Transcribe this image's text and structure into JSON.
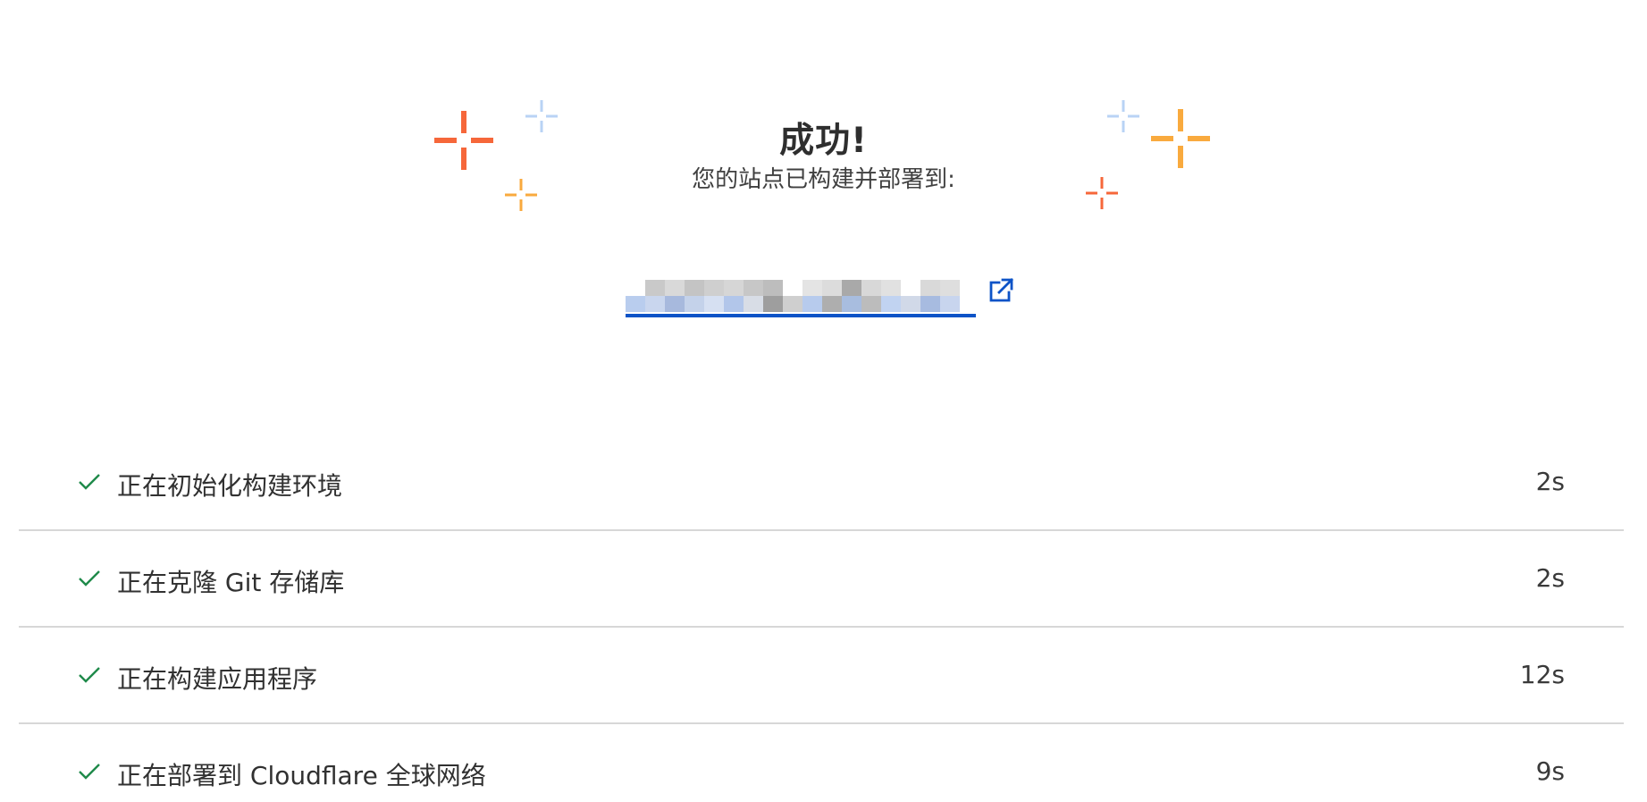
{
  "success": {
    "title": "成功!",
    "subtitle": "您的站点已构建并部署到:",
    "deployment_url": ""
  },
  "icons": {
    "external_link": "external-link-icon",
    "step_status": "check-icon",
    "decoration": "sparkle-icon"
  },
  "colors": {
    "link": "#0d53c7",
    "success": "#1f8a4a",
    "sparkle_orange": "#f6673a",
    "sparkle_amber": "#f9aa3e",
    "sparkle_blue": "#b9d3f5"
  },
  "build_steps": [
    {
      "label": "正在初始化构建环境",
      "duration": "2s"
    },
    {
      "label": "正在克隆 Git 存储库",
      "duration": "2s"
    },
    {
      "label": "正在构建应用程序",
      "duration": "12s"
    },
    {
      "label": "正在部署到 Cloudflare 全球网络",
      "duration": "9s"
    }
  ]
}
